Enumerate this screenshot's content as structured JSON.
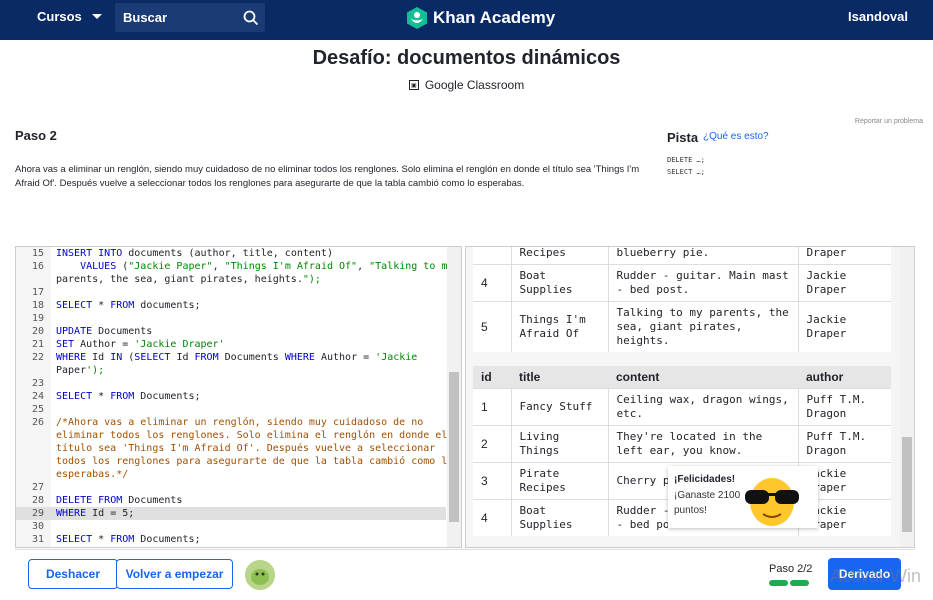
{
  "topbar": {
    "courses_label": "Cursos",
    "search_placeholder": "Buscar",
    "logo_text": "Khan Academy",
    "username": "Isandoval"
  },
  "header": {
    "title": "Desafío: documentos dinámicos",
    "classroom_label": "Google Classroom",
    "report_label": "Reportar un problema"
  },
  "step": {
    "heading": "Paso 2",
    "instructions": "Ahora vas a eliminar un renglón, siendo muy cuidadoso de no eliminar todos los renglones. Solo elimina el renglón en donde el título sea 'Things I'm Afraid Of'. Después vuelve a seleccionar todos los renglones para asegurarte de que la tabla cambió como lo esperabas."
  },
  "hint": {
    "label": "Pista",
    "link": "¿Qué es esto?",
    "lines": [
      "DELETE …;",
      "SELECT …;"
    ]
  },
  "editor": {
    "lines": [
      {
        "n": "15",
        "t": "INSERT INTO documents (author, title, content)"
      },
      {
        "n": "16",
        "t": "    VALUES (\"Jackie Paper\", \"Things I'm Afraid Of\", \"Talking to my"
      },
      {
        "n": "",
        "t": "parents, the sea, giant pirates, heights.\");"
      },
      {
        "n": "17",
        "t": ""
      },
      {
        "n": "18",
        "t": "SELECT * FROM documents;"
      },
      {
        "n": "19",
        "t": ""
      },
      {
        "n": "20",
        "t": "UPDATE Documents"
      },
      {
        "n": "21",
        "t": "SET Author = 'Jackie Draper'"
      },
      {
        "n": "22",
        "t": "WHERE Id IN (SELECT Id FROM Documents WHERE Author = 'Jackie"
      },
      {
        "n": "",
        "t": "Paper');"
      },
      {
        "n": "23",
        "t": ""
      },
      {
        "n": "24",
        "t": "SELECT * FROM Documents;"
      },
      {
        "n": "25",
        "t": ""
      },
      {
        "n": "26",
        "t": "/*Ahora vas a eliminar un renglón, siendo muy cuidadoso de no"
      },
      {
        "n": "",
        "t": "eliminar todos los renglones. Solo elimina el renglón en donde el"
      },
      {
        "n": "",
        "t": "título sea 'Things I'm Afraid Of'. Después vuelve a seleccionar"
      },
      {
        "n": "",
        "t": "todos los renglones para asegurarte de que la tabla cambió como lo"
      },
      {
        "n": "",
        "t": "esperabas.*/"
      },
      {
        "n": "27",
        "t": ""
      },
      {
        "n": "28",
        "t": "DELETE FROM Documents"
      },
      {
        "n": "29",
        "t": "WHERE Id = 5;"
      },
      {
        "n": "30",
        "t": ""
      },
      {
        "n": "31",
        "t": "SELECT * FROM Documents;"
      }
    ]
  },
  "results": {
    "table1_rows": [
      {
        "id": "",
        "title": "Recipes",
        "content": "blueberry pie.",
        "author": "Draper"
      },
      {
        "id": "4",
        "title": "Boat Supplies",
        "content": "Rudder - guitar. Main mast - bed post.",
        "author": "Jackie Draper"
      },
      {
        "id": "5",
        "title": "Things I'm Afraid Of",
        "content": "Talking to my parents, the sea, giant pirates, heights.",
        "author": "Jackie Draper"
      }
    ],
    "headers": [
      "id",
      "title",
      "content",
      "author"
    ],
    "table2_rows": [
      {
        "id": "1",
        "title": "Fancy Stuff",
        "content": "Ceiling wax, dragon wings, etc.",
        "author": "Puff T.M. Dragon"
      },
      {
        "id": "2",
        "title": "Living Things",
        "content": "They're located in the left ear, you know.",
        "author": "Puff T.M. Dragon"
      },
      {
        "id": "3",
        "title": "Pirate Recipes",
        "content": "Cherry pie, blueberry pie.",
        "author": "Jackie Draper"
      },
      {
        "id": "4",
        "title": "Boat Supplies",
        "content": "Rudder - guitar. Main mast - bed post.",
        "author": "Jackie Draper"
      }
    ]
  },
  "toast": {
    "title": "¡Felicidades!",
    "body": "¡Ganaste 2100 puntos!"
  },
  "footer": {
    "undo_label": "Deshacer",
    "reset_label": "Volver a empezar",
    "step_label": "Paso 2/2",
    "next_label": "Derivado",
    "watermark": "Activar Win"
  },
  "colors": {
    "topbar": "#0a2a66",
    "accent": "#1865f2",
    "progress": "#1fab54"
  }
}
